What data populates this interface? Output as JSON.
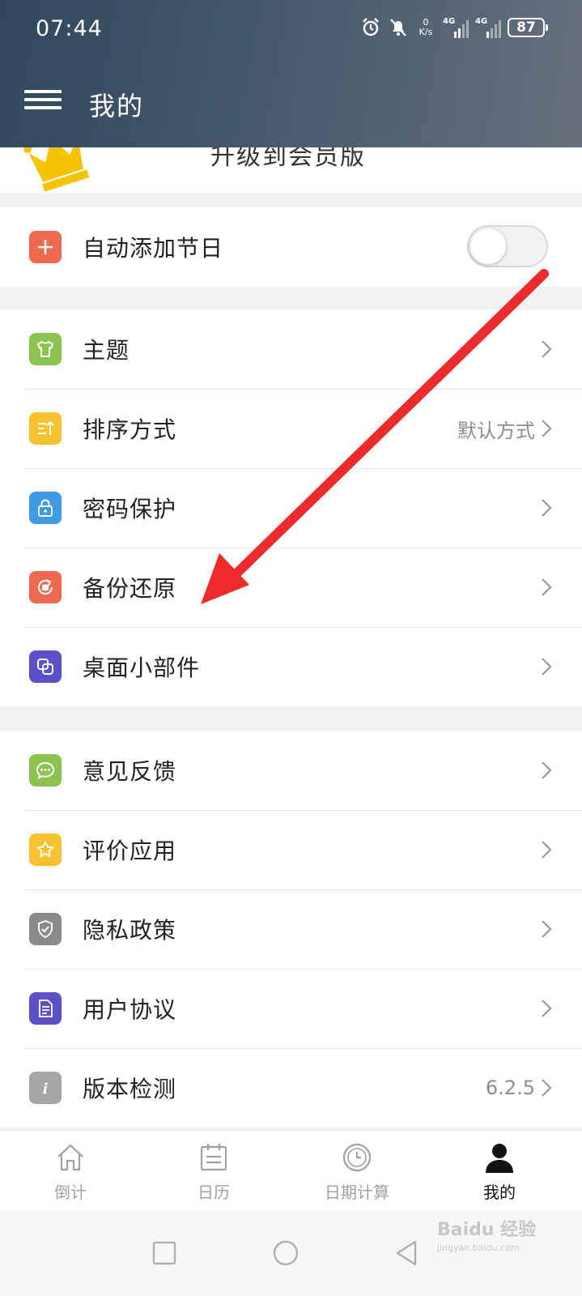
{
  "status_bar": {
    "time": "07:44",
    "net_speed_value": "0",
    "net_speed_unit": "K/s",
    "network_1": "4G",
    "network_2": "4G",
    "battery": "87"
  },
  "header": {
    "title": "我的"
  },
  "upgrade": {
    "label": "升级到会员版"
  },
  "auto_holiday": {
    "label": "自动添加节日",
    "toggle_on": false
  },
  "settings_group_1": [
    {
      "label": "主题",
      "icon": "shirt-icon",
      "color": "#8dc34f",
      "value": ""
    },
    {
      "label": "排序方式",
      "icon": "sort-icon",
      "color": "#f6c22f",
      "value": "默认方式"
    },
    {
      "label": "密码保护",
      "icon": "lock-icon",
      "color": "#3e9be8",
      "value": ""
    },
    {
      "label": "备份还原",
      "icon": "backup-icon",
      "color": "#ee6a4f",
      "value": ""
    },
    {
      "label": "桌面小部件",
      "icon": "widget-icon",
      "color": "#5b52c9",
      "value": ""
    }
  ],
  "settings_group_2": [
    {
      "label": "意见反馈",
      "icon": "chat-icon",
      "color": "#8dc34f",
      "value": ""
    },
    {
      "label": "评价应用",
      "icon": "star-icon",
      "color": "#f6c22f",
      "value": ""
    },
    {
      "label": "隐私政策",
      "icon": "shield-icon",
      "color": "#8a8a8a",
      "value": ""
    },
    {
      "label": "用户协议",
      "icon": "document-icon",
      "color": "#5b52c9",
      "value": ""
    },
    {
      "label": "版本检测",
      "icon": "info-icon",
      "color": "#a6a6a6",
      "value": "6.2.5"
    }
  ],
  "tabbar": [
    {
      "label": "倒计",
      "icon": "home-icon",
      "active": false
    },
    {
      "label": "日历",
      "icon": "calendar-icon",
      "active": false
    },
    {
      "label": "日期计算",
      "icon": "clock-icon",
      "active": false
    },
    {
      "label": "我的",
      "icon": "person-icon",
      "active": true
    }
  ],
  "watermark": {
    "brand": "Baidu 经验",
    "url": "jingyan.baidu.com"
  },
  "colors": {
    "header_start": "#31475c",
    "header_end": "#66707c",
    "arrow": "#ee2a2a",
    "add_icon": "#ee6a4f"
  }
}
